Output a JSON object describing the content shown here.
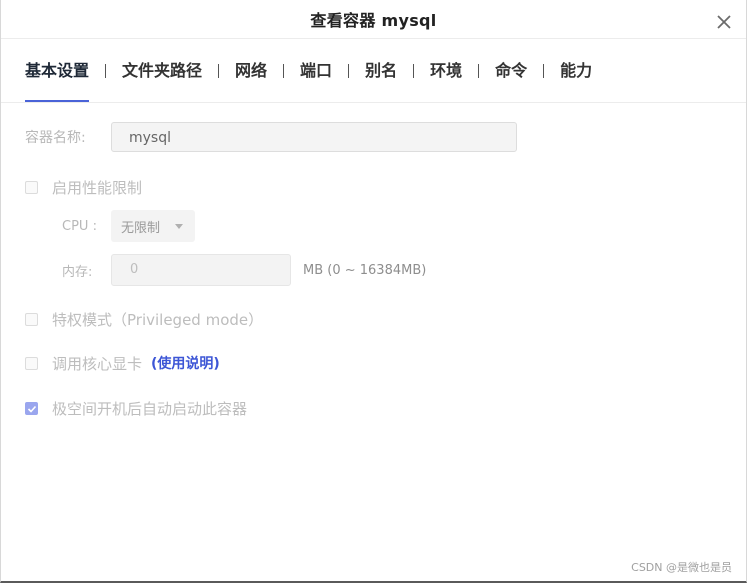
{
  "dialog": {
    "title": "查看容器 mysql",
    "close_icon": "close-icon"
  },
  "tabs": [
    {
      "label": "基本设置",
      "active": true
    },
    {
      "label": "文件夹路径",
      "active": false
    },
    {
      "label": "网络",
      "active": false
    },
    {
      "label": "端口",
      "active": false
    },
    {
      "label": "别名",
      "active": false
    },
    {
      "label": "环境",
      "active": false
    },
    {
      "label": "命令",
      "active": false
    },
    {
      "label": "能力",
      "active": false
    }
  ],
  "form": {
    "container_name": {
      "label": "容器名称:",
      "value": "mysql"
    },
    "perf_limit": {
      "label": "启用性能限制",
      "checked": false
    },
    "cpu": {
      "label": "CPU :",
      "value": "无限制"
    },
    "memory": {
      "label": "内存:",
      "value": "0",
      "unit": "MB (0 ~ 16384MB)"
    },
    "privileged": {
      "label": "特权模式（Privileged mode）",
      "checked": false
    },
    "gpu": {
      "label": "调用核心显卡",
      "link": "(使用说明)",
      "checked": false
    },
    "autostart": {
      "label": "极空间开机后自动启动此容器",
      "checked": true
    }
  },
  "watermark": "CSDN @是微也是员",
  "colors": {
    "accent": "#4a63d8",
    "link": "#3d56d6",
    "checked_box": "#9aa6ee"
  }
}
